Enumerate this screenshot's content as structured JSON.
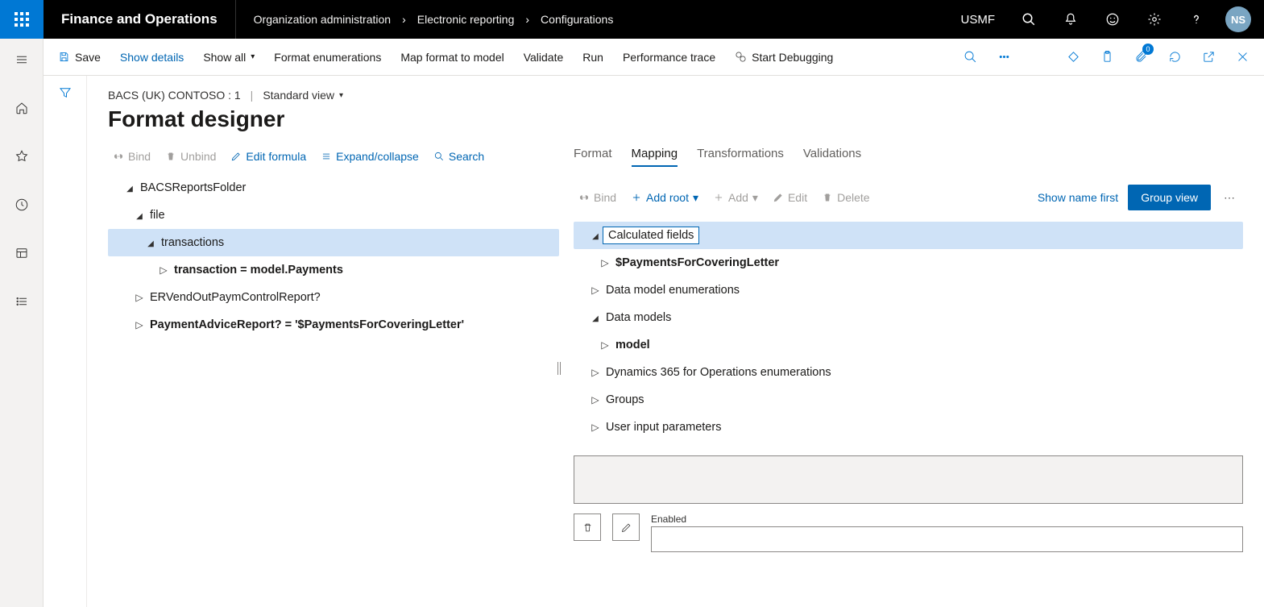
{
  "brand": "Finance and Operations",
  "breadcrumb": [
    "Organization administration",
    "Electronic reporting",
    "Configurations"
  ],
  "top_right": {
    "company": "USMF",
    "avatar": "NS",
    "badge": "0"
  },
  "actionbar": {
    "save": "Save",
    "show_details": "Show details",
    "show_all": "Show all",
    "format_enum": "Format enumerations",
    "map_format": "Map format to model",
    "validate": "Validate",
    "run": "Run",
    "perf_trace": "Performance trace",
    "start_debug": "Start Debugging"
  },
  "crumbline": {
    "text": "BACS (UK) CONTOSO : 1",
    "view": "Standard view"
  },
  "page_title": "Format designer",
  "left_tools": {
    "bind": "Bind",
    "unbind": "Unbind",
    "edit_formula": "Edit formula",
    "expand_collapse": "Expand/collapse",
    "search": "Search"
  },
  "tabs": {
    "format": "Format",
    "mapping": "Mapping",
    "transformations": "Transformations",
    "validations": "Validations"
  },
  "right_tools": {
    "bind": "Bind",
    "add_root": "Add root",
    "add": "Add",
    "edit": "Edit",
    "delete": "Delete",
    "show_name_first": "Show name first",
    "group_view": "Group view"
  },
  "left_tree": {
    "n0": "BACSReportsFolder",
    "n1": "file",
    "n2": "transactions",
    "n3": "transaction = model.Payments",
    "n4": "ERVendOutPaymControlReport?",
    "n5": "PaymentAdviceReport? = '$PaymentsForCoveringLetter'"
  },
  "right_tree": {
    "r0": "Calculated fields",
    "r1": "$PaymentsForCoveringLetter",
    "r2": "Data model enumerations",
    "r3": "Data models",
    "r4": "model",
    "r5": "Dynamics 365 for Operations enumerations",
    "r6": "Groups",
    "r7": "User input parameters"
  },
  "detail": {
    "enabled_label": "Enabled"
  }
}
